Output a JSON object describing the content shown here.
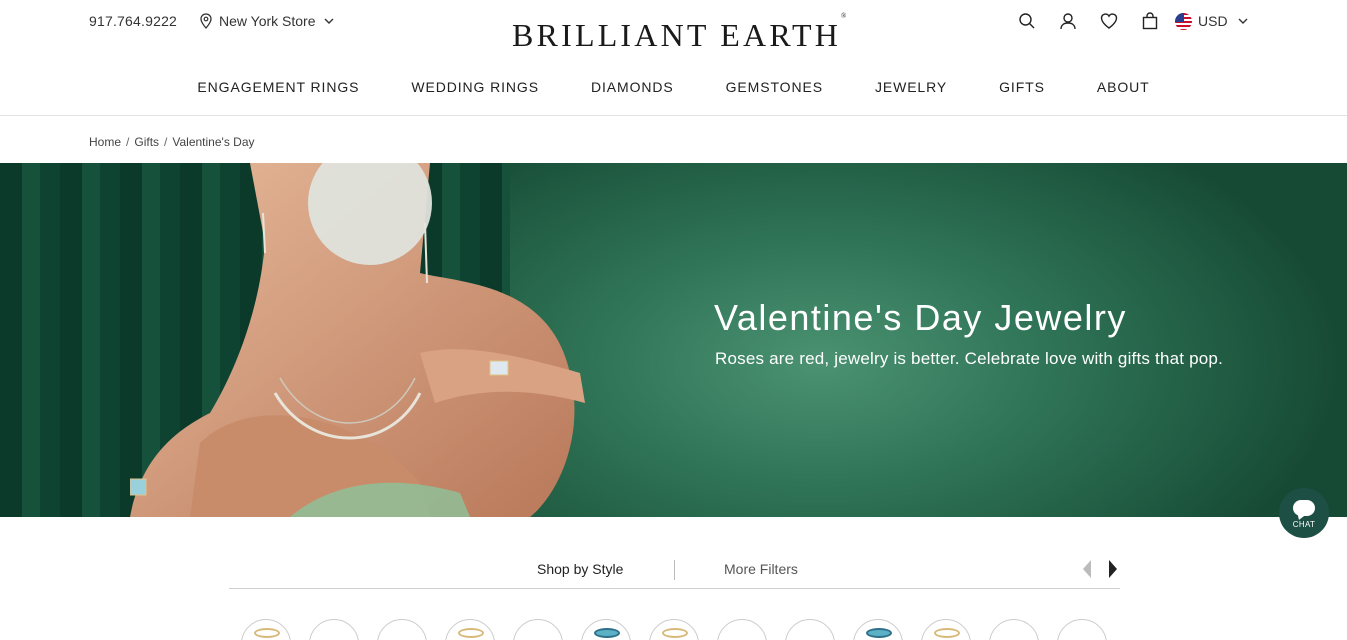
{
  "header": {
    "phone": "917.764.9222",
    "store": "New York Store",
    "logo": "BRILLIANT EARTH",
    "logo_mark": "®",
    "currency": "USD",
    "icons": [
      "search-icon",
      "account-icon",
      "heart-icon",
      "bag-icon",
      "flag-icon"
    ]
  },
  "nav": {
    "items": [
      "ENGAGEMENT RINGS",
      "WEDDING RINGS",
      "DIAMONDS",
      "GEMSTONES",
      "JEWELRY",
      "GIFTS",
      "ABOUT"
    ]
  },
  "breadcrumb": {
    "items": [
      "Home",
      "Gifts",
      "Valentine's Day"
    ],
    "separator": "/"
  },
  "hero": {
    "title": "Valentine's Day Jewelry",
    "subtitle": "Roses are red, jewelry is better. Celebrate love with gifts that pop.",
    "colors": {
      "background": "#2f7356",
      "curtain": "#0f4331"
    }
  },
  "chat": {
    "label": "CHAT",
    "color": "#1d4f45"
  },
  "filters": {
    "shop_by_style": "Shop by Style",
    "more_filters": "More Filters"
  }
}
